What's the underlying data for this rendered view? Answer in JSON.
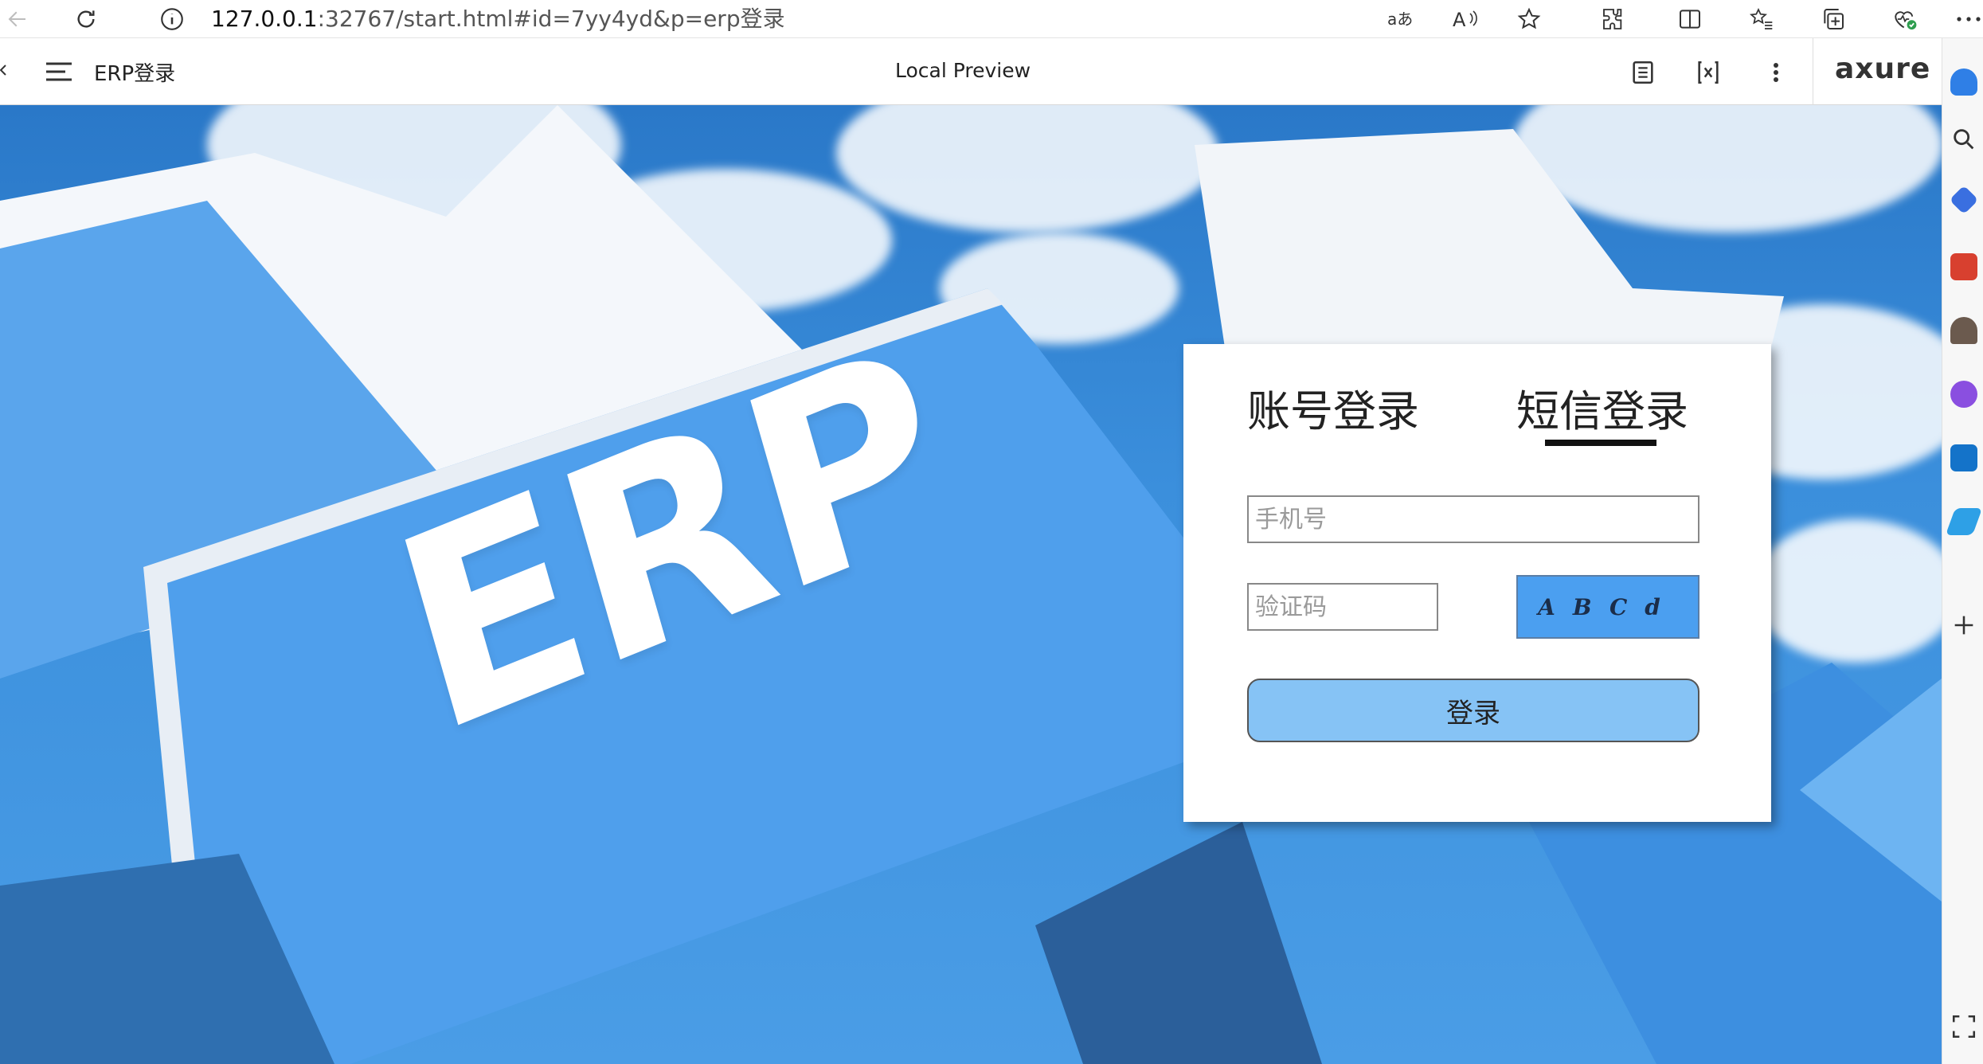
{
  "browser": {
    "address": {
      "host": "127.0.0.1",
      "path": ":32767/start.html#id=7yy4yd&p=erp登录"
    }
  },
  "axure_toolbar": {
    "page_title": "ERP登录",
    "center_title": "Local Preview",
    "logo": "axure"
  },
  "canvas": {
    "hero_text": "ERP"
  },
  "login": {
    "tabs": [
      {
        "label": "账号登录"
      },
      {
        "label": "短信登录",
        "active": true
      }
    ],
    "phone_placeholder": "手机号",
    "code_placeholder": "验证码",
    "captcha_text": "ABCd",
    "submit_label": "登录"
  },
  "colors": {
    "captcha_bg": "#4b9ff0",
    "submit_bg": "#86c3f5",
    "sky": "#2a78c8"
  },
  "icons": {
    "back": "back-arrow-icon",
    "refresh": "refresh-icon",
    "info": "info-icon",
    "translate": "translate-icon",
    "read_aloud": "read-aloud-icon",
    "favorite": "star-icon",
    "extensions": "puzzle-icon",
    "split": "split-screen-icon",
    "favorites": "favorites-list-icon",
    "collections": "collections-icon",
    "health": "browser-essentials-icon",
    "menu": "hamburger-menu-icon",
    "notes": "document-icon",
    "variables": "variable-icon",
    "more": "more-vertical-icon"
  }
}
